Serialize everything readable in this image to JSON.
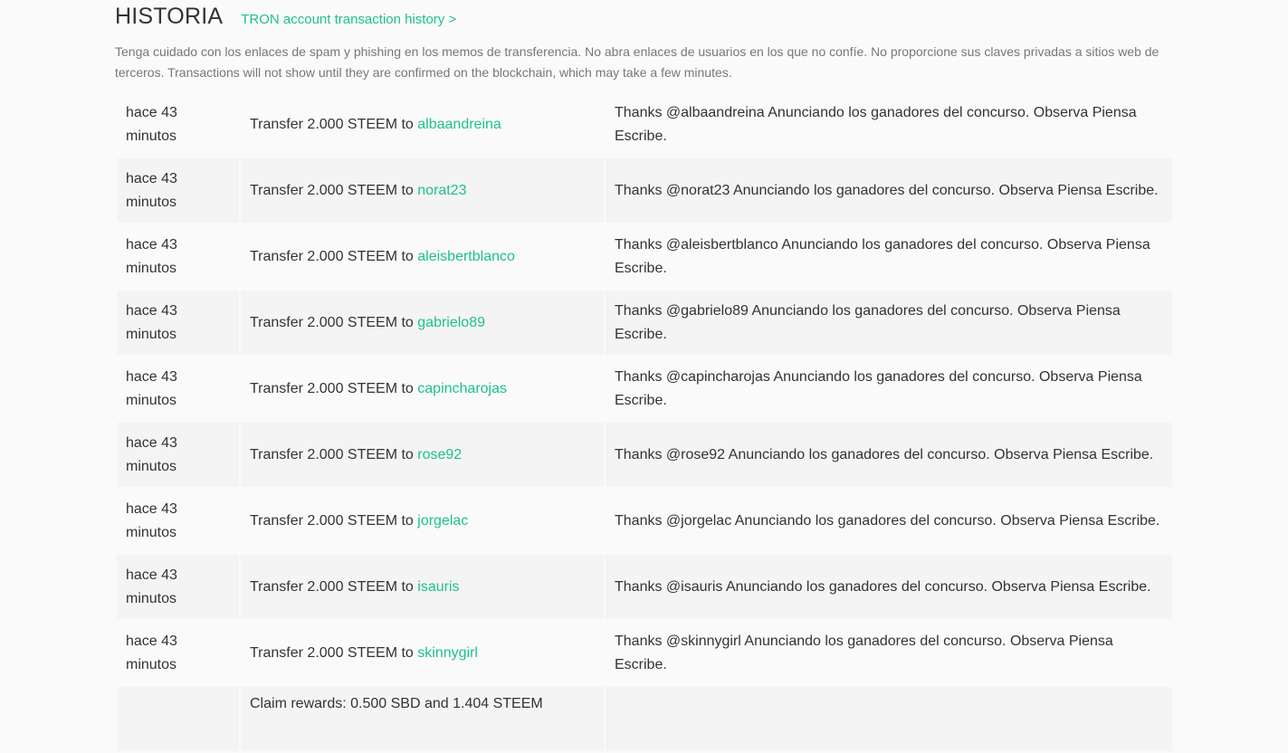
{
  "header": {
    "title": "HISTORIA",
    "tron_link": "TRON account transaction history >"
  },
  "warning": "Tenga cuidado con los enlaces de spam y phishing en los memos de transferencia. No abra enlaces de usuarios en los que no confíe. No proporcione sus claves privadas a sitios web de terceros. Transactions will not show until they are confirmed on the blockchain, which may take a few minutes.",
  "rows": [
    {
      "time": "hace 43 minutos",
      "op_prefix": "Transfer 2.000 STEEM to ",
      "user": "albaandreina",
      "memo": "Thanks @albaandreina Anunciando los ganadores del concurso. Observa Piensa Escribe."
    },
    {
      "time": "hace 43 minutos",
      "op_prefix": "Transfer 2.000 STEEM to ",
      "user": "norat23",
      "memo": "Thanks @norat23 Anunciando los ganadores del concurso. Observa Piensa Escribe."
    },
    {
      "time": "hace 43 minutos",
      "op_prefix": "Transfer 2.000 STEEM to ",
      "user": "aleisbertblanco",
      "memo": "Thanks @aleisbertblanco Anunciando los ganadores del concurso. Observa Piensa Escribe."
    },
    {
      "time": "hace 43 minutos",
      "op_prefix": "Transfer 2.000 STEEM to ",
      "user": "gabrielo89",
      "memo": "Thanks @gabrielo89 Anunciando los ganadores del concurso. Observa Piensa Escribe."
    },
    {
      "time": "hace 43 minutos",
      "op_prefix": "Transfer 2.000 STEEM to ",
      "user": "capincharojas",
      "memo": "Thanks @capincharojas Anunciando los ganadores del concurso. Observa Piensa Escribe."
    },
    {
      "time": "hace 43 minutos",
      "op_prefix": "Transfer 2.000 STEEM to ",
      "user": "rose92",
      "memo": "Thanks @rose92 Anunciando los ganadores del concurso. Observa Piensa Escribe."
    },
    {
      "time": "hace 43 minutos",
      "op_prefix": "Transfer 2.000 STEEM to ",
      "user": "jorgelac",
      "memo": "Thanks @jorgelac Anunciando los ganadores del concurso. Observa Piensa Escribe."
    },
    {
      "time": "hace 43 minutos",
      "op_prefix": "Transfer 2.000 STEEM to ",
      "user": "isauris",
      "memo": "Thanks @isauris Anunciando los ganadores del concurso. Observa Piensa Escribe."
    },
    {
      "time": "hace 43 minutos",
      "op_prefix": "Transfer 2.000 STEEM to ",
      "user": "skinnygirl",
      "memo": "Thanks @skinnygirl Anunciando los ganadores del concurso. Observa Piensa Escribe."
    }
  ],
  "partial_row": {
    "op_partial": "Claim rewards: 0.500 SBD and 1.404 STEEM"
  }
}
